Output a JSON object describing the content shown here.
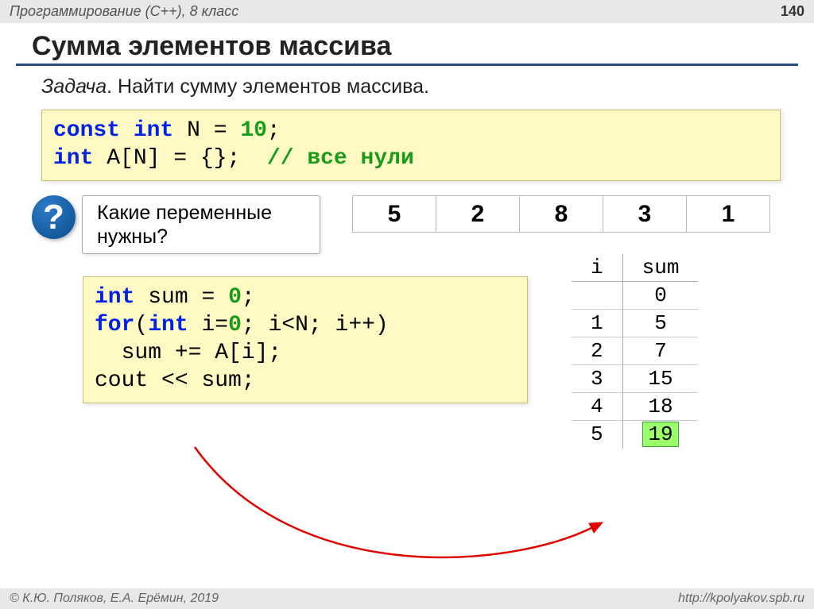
{
  "header": {
    "left": "Программирование (C++), 8 класс",
    "page": "140"
  },
  "title": "Сумма элементов массива",
  "task": {
    "label": "Задача",
    "text": ". Найти сумму элементов массива."
  },
  "code1": {
    "keyword_const": "const",
    "keyword_int1": "int",
    "nvar": "N",
    "eq": "=",
    "ten": "10",
    "semicolon": ";",
    "keyword_int2": "int",
    "arr": "A[N]",
    "eq2": "=",
    "braces": "{}",
    "semi2": ";",
    "comment": "// все нули"
  },
  "question": {
    "mark": "?",
    "text": "Какие переменные нужны?"
  },
  "array_values": [
    "5",
    "2",
    "8",
    "3",
    "1"
  ],
  "code2": {
    "int": "int",
    "sum": "sum",
    "eq": "=",
    "zero": "0",
    "semi": ";",
    "for": "for",
    "open": "(",
    "int2": "int",
    "i0": "i=",
    "zero2": "0",
    "cond": "; i<N; i++)",
    "body": "  sum += A[i];",
    "cout": "cout << sum;"
  },
  "trace": {
    "h1": "i",
    "h2": "sum",
    "rows": [
      {
        "i": "",
        "sum": "0"
      },
      {
        "i": "1",
        "sum": "5"
      },
      {
        "i": "2",
        "sum": "7"
      },
      {
        "i": "3",
        "sum": "15"
      },
      {
        "i": "4",
        "sum": "18"
      },
      {
        "i": "5",
        "sum": "19",
        "hl": true
      }
    ]
  },
  "footer": {
    "left": "© К.Ю. Поляков, Е.А. Ерёмин, 2019",
    "right": "http://kpolyakov.spb.ru"
  }
}
